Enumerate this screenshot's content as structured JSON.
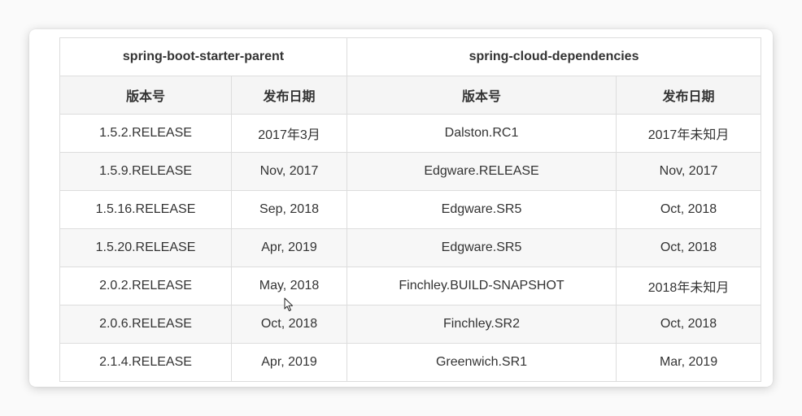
{
  "table": {
    "groups": [
      "spring-boot-starter-parent",
      "spring-cloud-dependencies"
    ],
    "columns": [
      "版本号",
      "发布日期",
      "版本号",
      "发布日期"
    ],
    "rows": [
      [
        "1.5.2.RELEASE",
        "2017年3月",
        "Dalston.RC1",
        "2017年未知月"
      ],
      [
        "1.5.9.RELEASE",
        "Nov, 2017",
        "Edgware.RELEASE",
        "Nov, 2017"
      ],
      [
        "1.5.16.RELEASE",
        "Sep, 2018",
        "Edgware.SR5",
        "Oct, 2018"
      ],
      [
        "1.5.20.RELEASE",
        "Apr, 2019",
        "Edgware.SR5",
        "Oct, 2018"
      ],
      [
        "2.0.2.RELEASE",
        "May, 2018",
        "Finchley.BUILD-SNAPSHOT",
        "2018年未知月"
      ],
      [
        "2.0.6.RELEASE",
        "Oct, 2018",
        "Finchley.SR2",
        "Oct, 2018"
      ],
      [
        "2.1.4.RELEASE",
        "Apr, 2019",
        "Greenwich.SR1",
        "Mar, 2019"
      ]
    ]
  },
  "colors": {
    "border": "#dddddd",
    "header_bg": "#f5f5f5",
    "stripe_bg": "#f7f7f7",
    "text": "#333333"
  }
}
